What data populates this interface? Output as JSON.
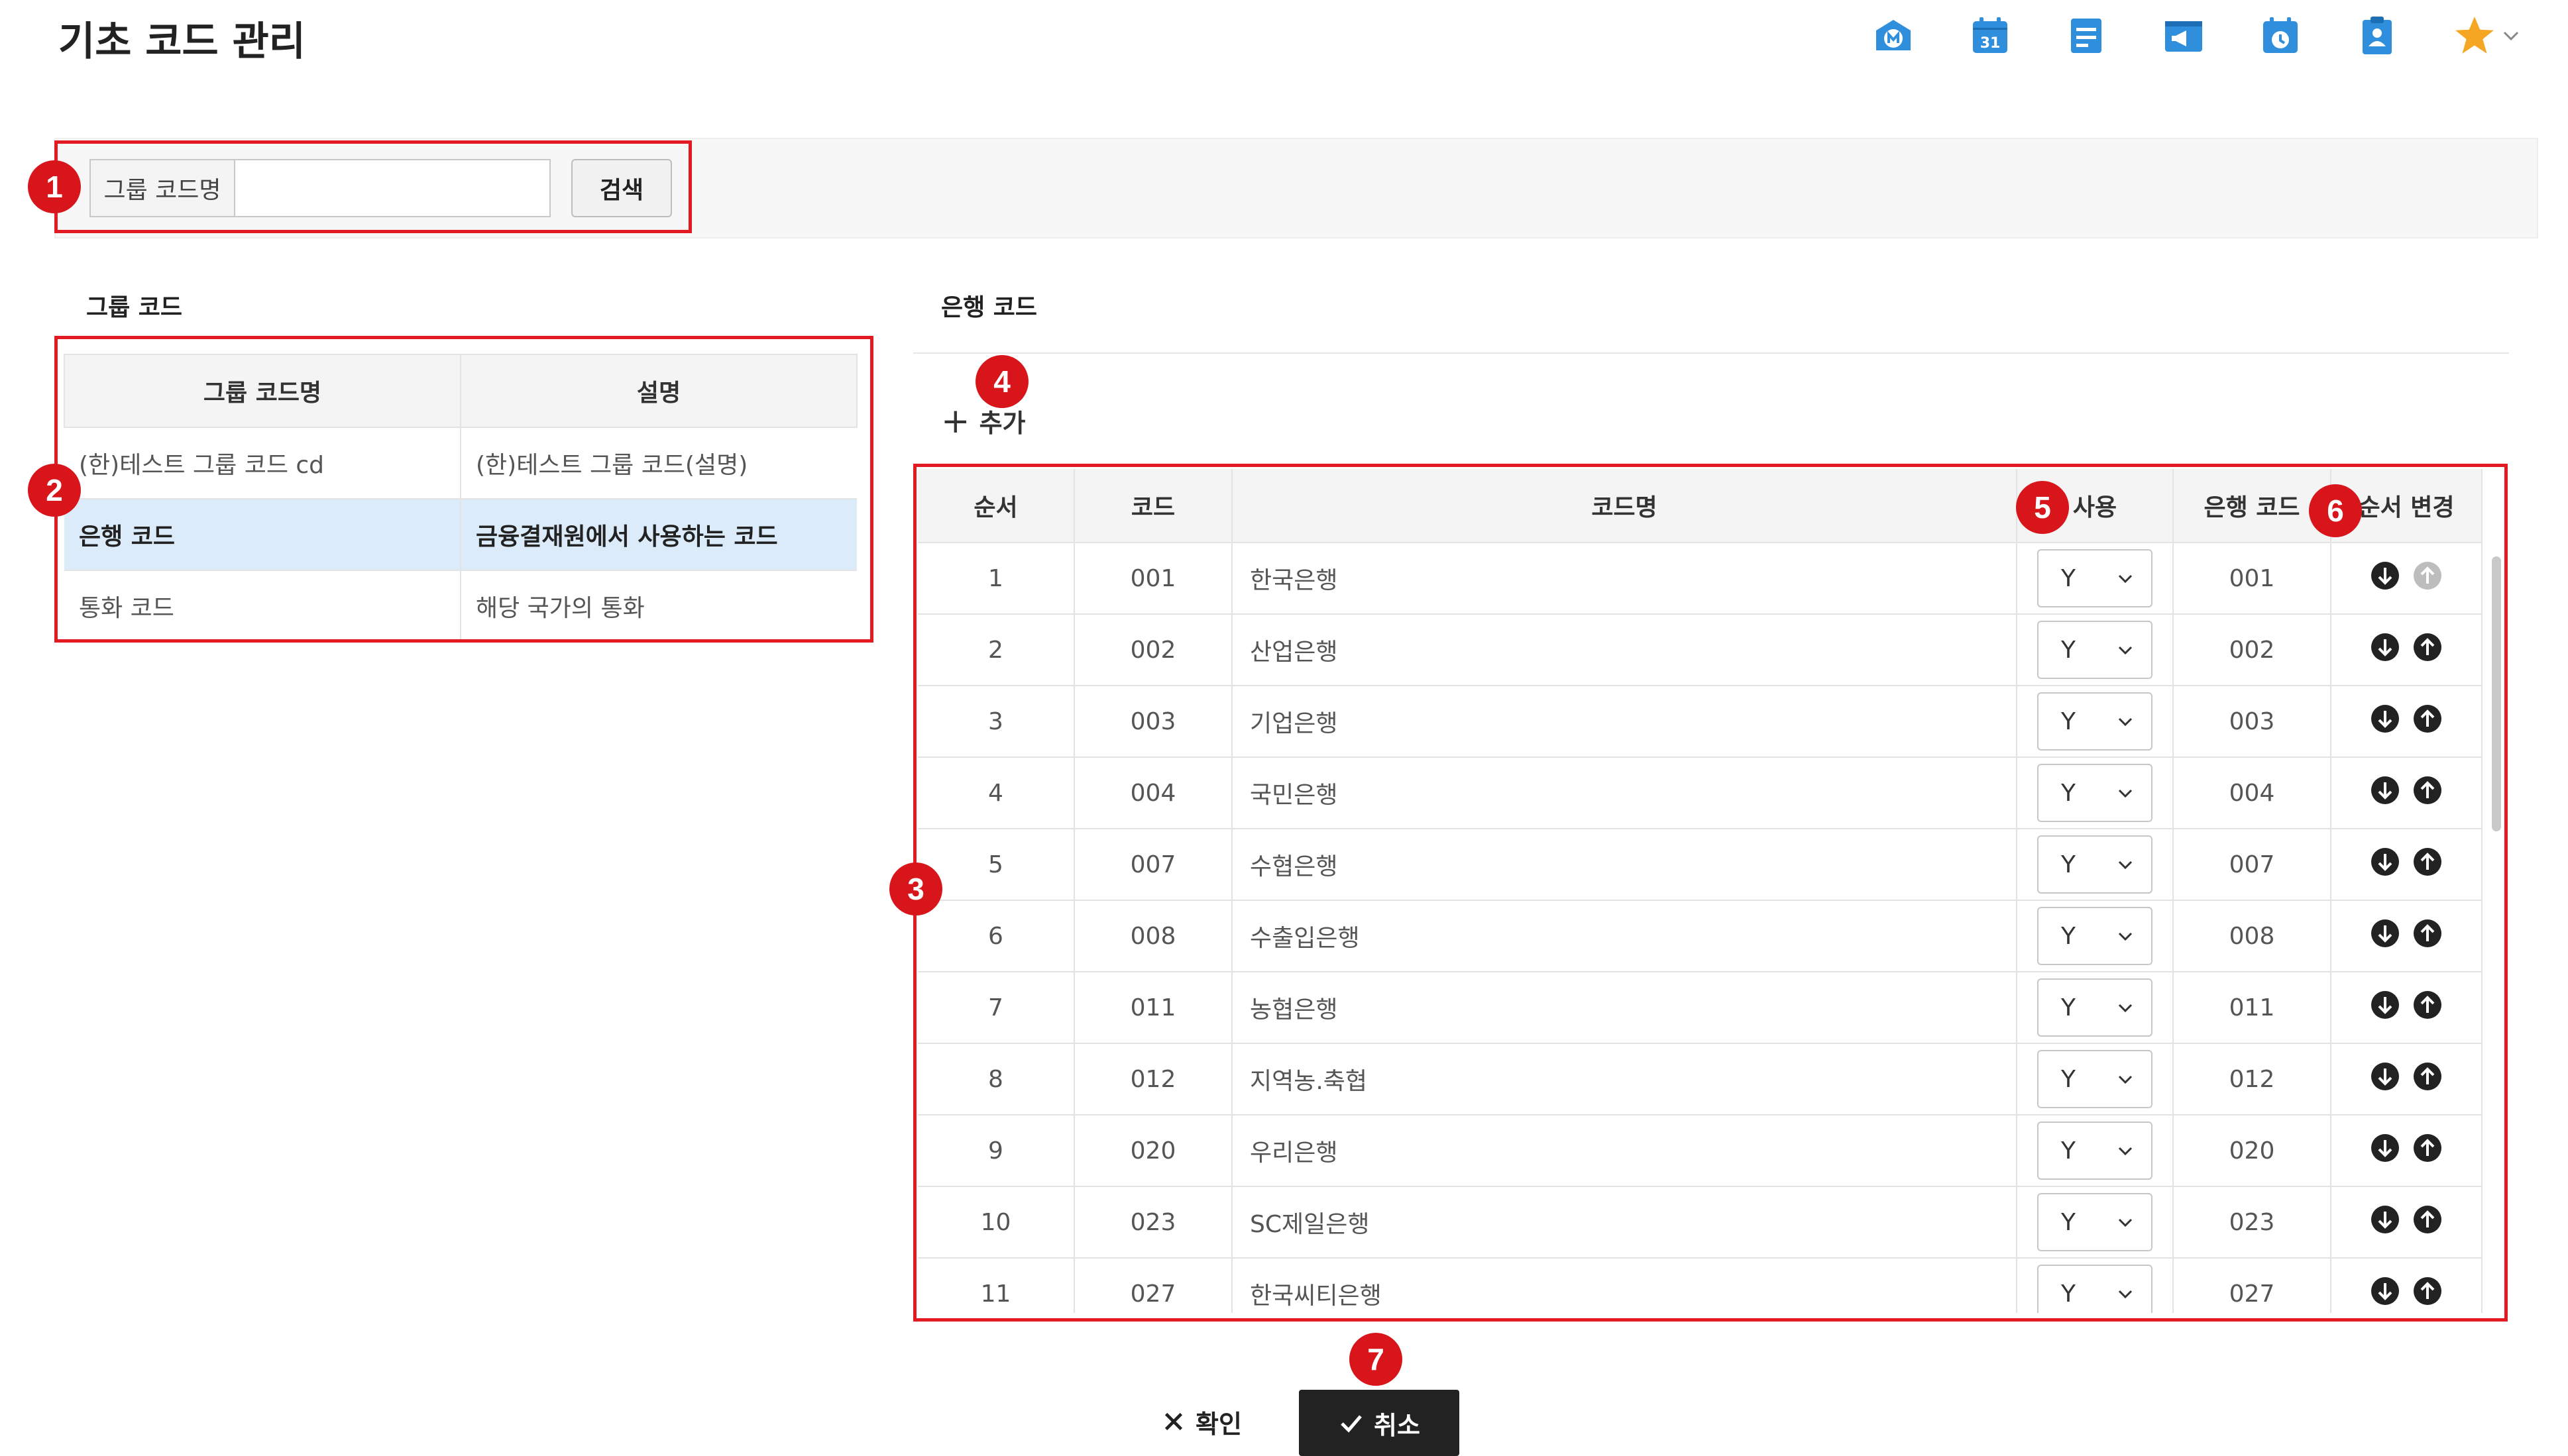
{
  "page": {
    "title": "기초 코드 관리"
  },
  "header_icons": [
    "mail-icon",
    "calendar-icon",
    "board-icon",
    "notice-icon",
    "schedule-icon",
    "clipboard-icon",
    "favorite-star-icon"
  ],
  "header": {
    "calendar_day": "31"
  },
  "search": {
    "label": "그룹 코드명",
    "value": "",
    "placeholder": "",
    "button_label": "검색"
  },
  "group_code": {
    "section_title": "그룹 코드",
    "columns": [
      "그룹 코드명",
      "설명"
    ],
    "rows": [
      {
        "name": "(한)테스트 그룹 코드 cd",
        "description": "(한)테스트 그룹 코드(설명)"
      },
      {
        "name": "은행 코드",
        "description": "금융결재원에서 사용하는 코드",
        "selected": true
      },
      {
        "name": "통화 코드",
        "description": "해당 국가의 통화"
      }
    ]
  },
  "bank_code": {
    "section_title": "은행 코드",
    "add_label": "추가",
    "columns": [
      "순서",
      "코드",
      "코드명",
      "사용",
      "은행 코드",
      "순서 변경"
    ],
    "rows": [
      {
        "order": "1",
        "code": "001",
        "name": "한국은행",
        "use": "Y",
        "bank_code": "001"
      },
      {
        "order": "2",
        "code": "002",
        "name": "산업은행",
        "use": "Y",
        "bank_code": "002"
      },
      {
        "order": "3",
        "code": "003",
        "name": "기업은행",
        "use": "Y",
        "bank_code": "003"
      },
      {
        "order": "4",
        "code": "004",
        "name": "국민은행",
        "use": "Y",
        "bank_code": "004"
      },
      {
        "order": "5",
        "code": "007",
        "name": "수협은행",
        "use": "Y",
        "bank_code": "007"
      },
      {
        "order": "6",
        "code": "008",
        "name": "수출입은행",
        "use": "Y",
        "bank_code": "008"
      },
      {
        "order": "7",
        "code": "011",
        "name": "농협은행",
        "use": "Y",
        "bank_code": "011"
      },
      {
        "order": "8",
        "code": "012",
        "name": "지역농.축협",
        "use": "Y",
        "bank_code": "012"
      },
      {
        "order": "9",
        "code": "020",
        "name": "우리은행",
        "use": "Y",
        "bank_code": "020"
      },
      {
        "order": "10",
        "code": "023",
        "name": "SC제일은행",
        "use": "Y",
        "bank_code": "023"
      },
      {
        "order": "11",
        "code": "027",
        "name": "한국씨티은행",
        "use": "Y",
        "bank_code": "027"
      }
    ]
  },
  "annotations": [
    "1",
    "2",
    "3",
    "4",
    "5",
    "6",
    "7"
  ],
  "footer": {
    "confirm_label": "확인",
    "cancel_label": "취소"
  },
  "colors": {
    "annotation_red": "#e21b22",
    "selected_row": "#dcebfa",
    "header_icon_blue": "#2f8fdc",
    "star": "#f5a623",
    "cancel_button": "#222222"
  }
}
